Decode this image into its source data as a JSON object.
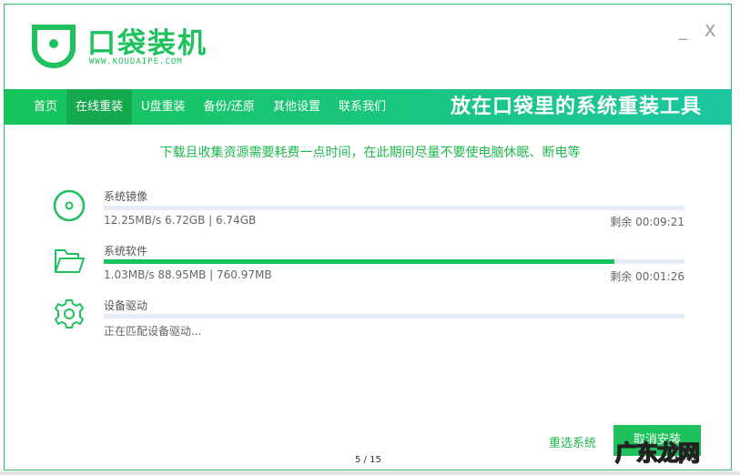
{
  "header": {
    "brand": "口袋装机",
    "url": "WWW.KOUDAIPE.COM",
    "minimize": "_",
    "close": "X"
  },
  "nav": {
    "items": [
      {
        "label": "首页"
      },
      {
        "label": "在线重装"
      },
      {
        "label": "U盘重装"
      },
      {
        "label": "备份/还原"
      },
      {
        "label": "其他设置"
      },
      {
        "label": "联系我们"
      }
    ],
    "active": 1,
    "slogan": "放在口袋里的系统重装工具"
  },
  "notice": "下载且收集资源需要耗费一点时间，在此期间尽量不要使电脑休眠、断电等",
  "downloads": [
    {
      "title": "系统镜像",
      "icon": "disc-icon",
      "stat": "12.25MB/s 6.72GB | 6.74GB",
      "remain": "剩余 00:09:21",
      "progress": 0
    },
    {
      "title": "系统软件",
      "icon": "folder-icon",
      "stat": "1.03MB/s 88.95MB | 760.97MB",
      "remain": "剩余 00:01:26",
      "progress": 0.88
    },
    {
      "title": "设备驱动",
      "icon": "gear-icon",
      "stat": "正在匹配设备驱动...",
      "progress": 0
    }
  ],
  "buttons": {
    "reselect": "重选系统",
    "cancel": "取消安装"
  },
  "pagination": "5 / 15",
  "watermark": "广东龙网",
  "colors": {
    "accent": "#1fc15d"
  }
}
